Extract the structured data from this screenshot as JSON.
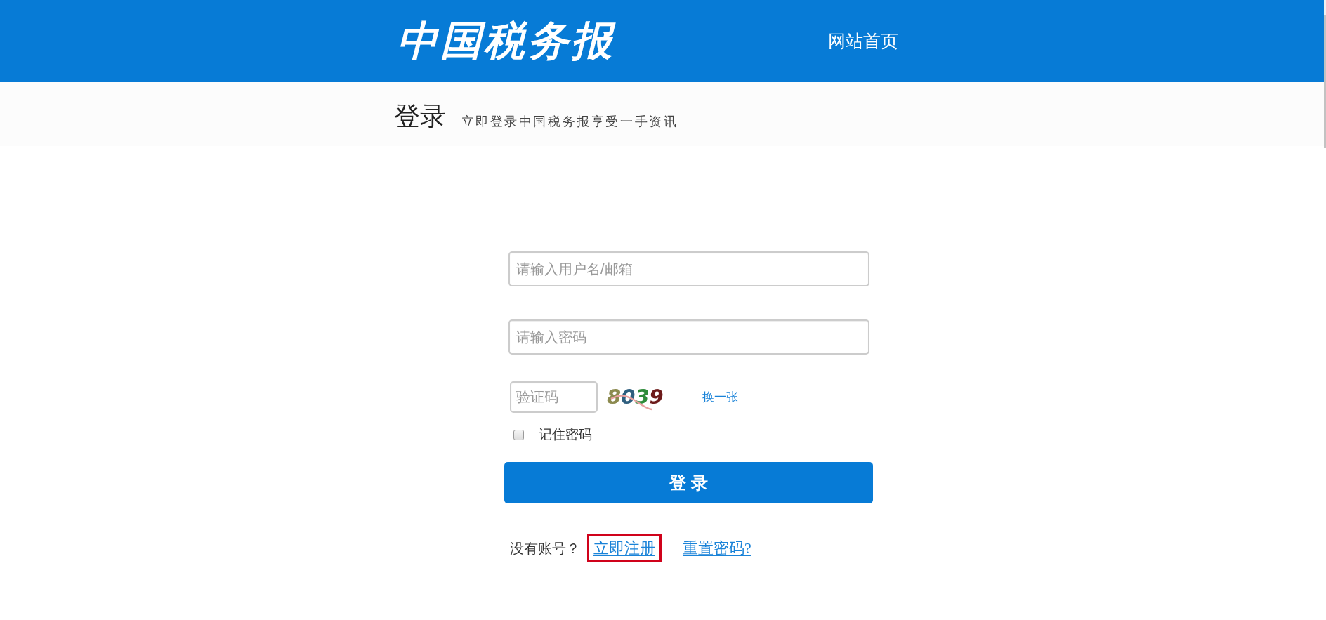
{
  "header": {
    "logo": "中国税务报",
    "nav_link": "网站首页"
  },
  "page_heading": {
    "title": "登录",
    "subtitle": "立即登录中国税务报享受一手资讯"
  },
  "login_form": {
    "fields": [
      {
        "placeholder": "请输入用户名/邮箱"
      },
      {
        "placeholder": "请输入密码"
      }
    ],
    "captcha": {
      "placeholder": "验证码",
      "image_text": "8039",
      "refresh_link": "换一张"
    },
    "remember": {
      "label": "记住密码",
      "checked": false
    },
    "submit_button": "登 录",
    "footer": {
      "prompt": "没有账号？",
      "links": [
        {
          "label": "立即注册",
          "highlighted": true
        },
        {
          "label": "重置密码?",
          "highlighted": false
        }
      ]
    }
  }
}
